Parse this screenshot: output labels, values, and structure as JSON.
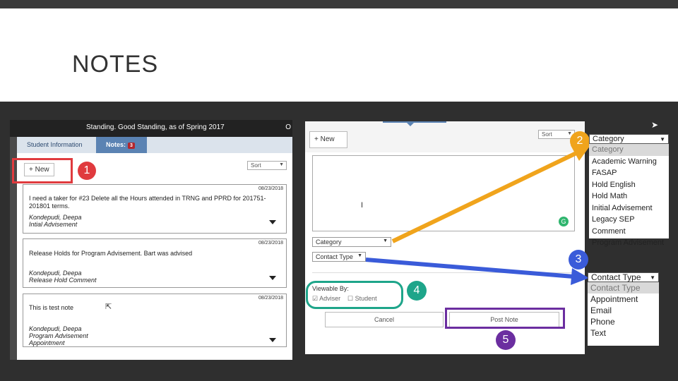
{
  "slide": {
    "title": "NOTES"
  },
  "panel1": {
    "header_text": "Standing. Good Standing, as of Spring 2017",
    "header_o": "O",
    "tabs": [
      {
        "label": "Student Information"
      },
      {
        "label": "Notes:",
        "badge": "3"
      }
    ],
    "new_button": "+ New",
    "sort": "Sort",
    "notes": [
      {
        "date": "08/23/2018",
        "text": "I need a taker for #23 Delete all the Hours attended in TRNG and PPRD for 201751-201801 terms.",
        "author": "Kondepudi, Deepa",
        "category": "Intial Advisement"
      },
      {
        "date": "08/23/2018",
        "text": "Release Holds for Program Advisement. Bart was advised",
        "author": "Kondepudi, Deepa",
        "category": "Release Hold Comment"
      },
      {
        "date": "08/23/2018",
        "text": "This is test note",
        "author": "Kondepudi, Deepa",
        "category": "Program Advisement",
        "extra": "Appointment"
      }
    ]
  },
  "panel2": {
    "new_button": "+ New",
    "sort": "Sort",
    "text_cursor": "I",
    "g_icon": "G",
    "category_select": "Category",
    "contact_select": "Contact Type",
    "viewable_label": "Viewable By:",
    "adviser_label": "Adviser",
    "student_label": "Student",
    "cancel_button": "Cancel",
    "post_button": "Post Note"
  },
  "category_dropdown": {
    "head": "Category",
    "options": [
      "Category",
      "Academic Warning",
      "FASAP",
      "Hold English",
      "Hold Math",
      "Initial Advisement",
      "Legacy SEP Comment",
      "Program Advisement"
    ]
  },
  "contact_dropdown": {
    "head": "Contact Type",
    "options": [
      "Contact Type",
      "Appointment",
      "Email",
      "Phone",
      "Text"
    ]
  },
  "callouts": [
    "1",
    "2",
    "3",
    "4",
    "5"
  ],
  "colors": {
    "red": "#e03a3e",
    "orange": "#f0a41c",
    "blue": "#3a5bd9",
    "teal": "#1ea58a",
    "purple": "#6b2ea0"
  }
}
